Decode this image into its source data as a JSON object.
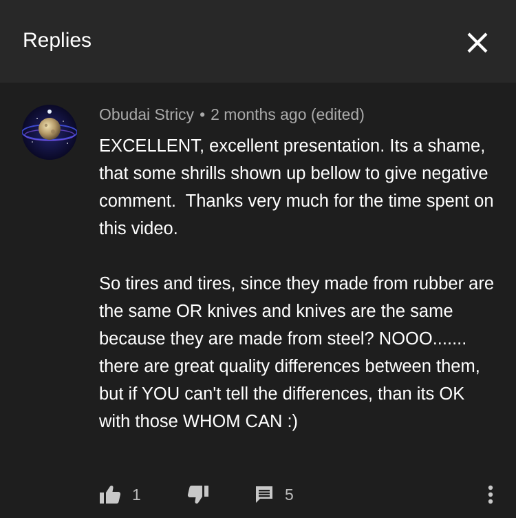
{
  "header": {
    "title": "Replies",
    "close_icon": "close-icon"
  },
  "comment": {
    "author": "Obudai Stricy",
    "separator": "•",
    "time": "2 months ago (edited)",
    "avatar_icon": "planet-avatar",
    "paragraphs": [
      "EXCELLENT, excellent presentation. Its a shame, that some shrills shown up bellow to give negative comment.  Thanks very much for the time spent on this video.",
      "So tires and tires, since they made from rubber are the same OR knives and knives are the same because they are made from steel? NOOO....... there are great quality differences between them, but if YOU can't tell the differences, than its OK with those WHOM CAN :)"
    ]
  },
  "actions": {
    "like_count": "1",
    "reply_count": "5",
    "like_icon": "thumbs-up-icon",
    "dislike_icon": "thumbs-down-icon",
    "reply_icon": "comment-icon",
    "more_icon": "more-vert-icon"
  },
  "colors": {
    "background": "#1e1e1e",
    "header_background": "#282828",
    "text": "#ffffff",
    "muted_text": "#aaaaaa",
    "icon": "#c8c8c8",
    "status_dot": "#ff3b30"
  }
}
